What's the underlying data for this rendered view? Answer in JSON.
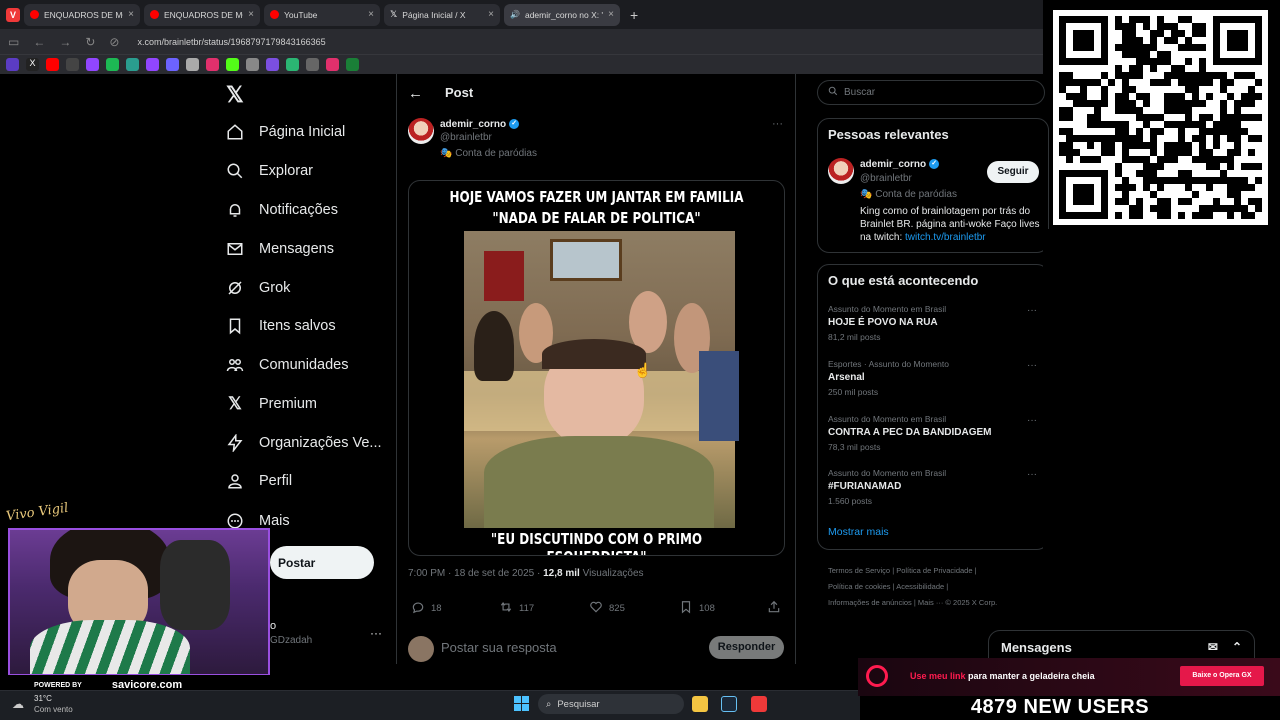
{
  "browser": {
    "tabs": [
      {
        "label": "ENQUADROS DE MOTO",
        "icon": "youtube-icon",
        "color": "#ff0000"
      },
      {
        "label": "ENQUADROS DE MOTO",
        "icon": "youtube-icon",
        "color": "#ff0000"
      },
      {
        "label": "YouTube",
        "icon": "youtube-icon",
        "color": "#ff0000"
      },
      {
        "label": "Página Inicial / X",
        "icon": "x-icon",
        "color": "#ffffff"
      },
      {
        "label": "ademir_corno no X: \"H",
        "icon": "audio-icon",
        "color": "#bbbbbb"
      }
    ],
    "new_tab": "+",
    "url": "x.com/brainletbr/status/1968797179843166365"
  },
  "nav": {
    "items": [
      {
        "label": "Página Inicial",
        "icon": "home-icon"
      },
      {
        "label": "Explorar",
        "icon": "search-icon"
      },
      {
        "label": "Notificações",
        "icon": "bell-icon"
      },
      {
        "label": "Mensagens",
        "icon": "mail-icon"
      },
      {
        "label": "Grok",
        "icon": "grok-icon"
      },
      {
        "label": "Itens salvos",
        "icon": "bookmark-icon"
      },
      {
        "label": "Comunidades",
        "icon": "people-icon"
      },
      {
        "label": "Premium",
        "icon": "x-icon"
      },
      {
        "label": "Organizações Ve...",
        "icon": "bolt-icon"
      },
      {
        "label": "Perfil",
        "icon": "person-icon"
      },
      {
        "label": "Mais",
        "icon": "more-icon"
      }
    ],
    "post_button": "Postar",
    "profile_name": "o",
    "profile_handle": "GDzadah"
  },
  "post": {
    "header": "Post",
    "author_name": "ademir_corno",
    "author_handle": "@brainletbr",
    "author_tag": "Conta de paródias",
    "caption_top_1": "HOJE VAMOS FAZER UM JANTAR EM FAMILIA",
    "caption_top_2": "\"NADA DE FALAR DE POLITICA\"",
    "caption_bottom": "\"EU DISCUTINDO COM O PRIMO ESQUERDISTA\"",
    "timestamp": "7:00 PM · 18 de set de 2025 · ",
    "views_count": "12,8 mil",
    "views_label": " Visualizações",
    "replies": "18",
    "reposts": "117",
    "likes": "825",
    "bookmarks": "108",
    "reply_placeholder": "Postar sua resposta",
    "reply_button": "Responder"
  },
  "right": {
    "search_placeholder": "Buscar",
    "relevant_title": "Pessoas relevantes",
    "relevant_name": "ademir_corno",
    "relevant_handle": "@brainletbr",
    "relevant_tag": "Conta de paródias",
    "relevant_bio": "King corno of brainlotagem por trás do Brainlet BR. página anti-woke Faço lives na twitch: ",
    "relevant_link": "twitch.tv/brainletbr",
    "follow_button": "Seguir",
    "trends_title": "O que está acontecendo",
    "trends": [
      {
        "context": "Assunto do Momento em Brasil",
        "name": "HOJE É POVO NA RUA",
        "count": "81,2 mil posts"
      },
      {
        "context": "Esportes · Assunto do Momento",
        "name": "Arsenal",
        "count": "250 mil posts"
      },
      {
        "context": "Assunto do Momento em Brasil",
        "name": "CONTRA A PEC DA BANDIDAGEM",
        "count": "78,3 mil posts"
      },
      {
        "context": "Assunto do Momento em Brasil",
        "name": "#FURIANAMAD",
        "count": "1.560 posts"
      }
    ],
    "show_more": "Mostrar mais",
    "footer_1": "Termos de Serviço  |  Política de Privacidade  |",
    "footer_2": "Política de cookies  |  Acessibilidade  |",
    "footer_3": "Informações de anúncios  |  Mais ···  © 2025 X Corp.",
    "messages": "Mensagens"
  },
  "stream": {
    "powered": "POWERED BY",
    "brand": "savicore.com",
    "signature": "Vivo Vigil",
    "ad_text_hl": "Use meu link",
    "ad_text": " para manter a geladeira cheia",
    "ad_button": "Baixe o Opera GX",
    "new_users": "4879 NEW USERS"
  },
  "taskbar": {
    "temp": "31°C",
    "condition": "Com vento",
    "search": "Pesquisar"
  }
}
